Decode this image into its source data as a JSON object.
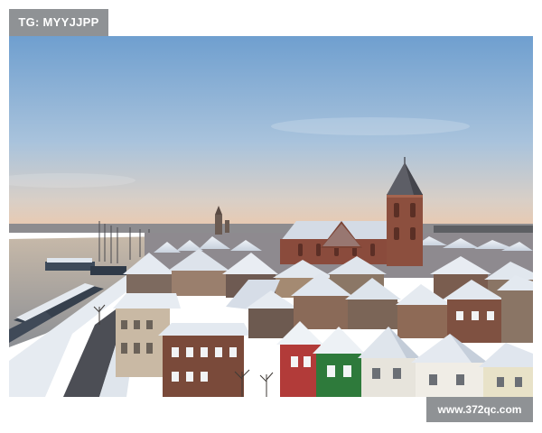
{
  "watermarks": {
    "top_left": "TG: MYYJJPP",
    "bottom_right": "www.372qc.com"
  },
  "photo": {
    "subject": "snow-covered-town-at-dusk",
    "colors": {
      "sky_top": "#6d9fcf",
      "sky_horizon": "#e7c8b0",
      "water": "#a7a39b",
      "roof_snow": "#e7ecf3",
      "brick": "#7a4a3a",
      "green_facade": "#2f7a3a",
      "red_facade": "#b03a3a"
    }
  }
}
